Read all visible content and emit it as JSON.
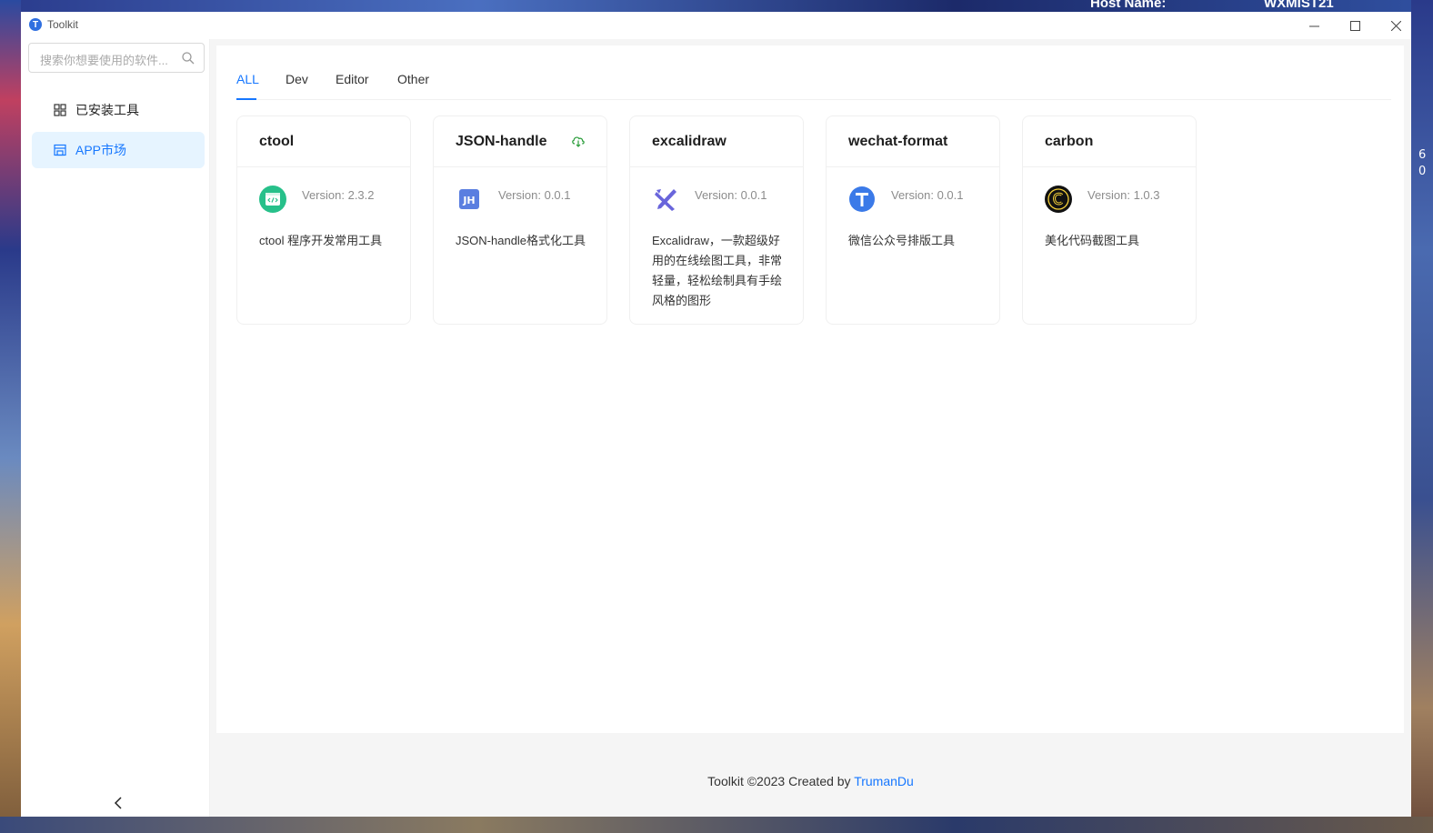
{
  "desktop": {
    "host_label": "Host Name:",
    "host_value": "WXMIST21",
    "edge_digits": [
      "6",
      "0"
    ]
  },
  "window": {
    "title": "Toolkit",
    "logo_letter": "T",
    "controls": [
      "minimize",
      "maximize",
      "close"
    ]
  },
  "sidebar": {
    "search_placeholder": "搜索你想要使用的软件...",
    "items": [
      {
        "label": "已安装工具",
        "icon": "grid-icon",
        "active": false
      },
      {
        "label": "APP市场",
        "icon": "store-icon",
        "active": true
      }
    ],
    "collapse_icon": "chevron-left-icon"
  },
  "tabs": [
    {
      "label": "ALL",
      "active": true
    },
    {
      "label": "Dev",
      "active": false
    },
    {
      "label": "Editor",
      "active": false
    },
    {
      "label": "Other",
      "active": false
    }
  ],
  "cards": [
    {
      "title": "ctool",
      "version": "Version: 2.3.2",
      "description": "ctool 程序开发常用工具",
      "logo": "ctool-logo",
      "downloadable": false
    },
    {
      "title": "JSON-handle",
      "version": "Version: 0.0.1",
      "description": "JSON-handle格式化工具",
      "logo": "json-handle-logo",
      "downloadable": true
    },
    {
      "title": "excalidraw",
      "version": "Version: 0.0.1",
      "description": "Excalidraw，一款超级好用的在线绘图工具，非常轻量，轻松绘制具有手绘风格的图形",
      "logo": "excalidraw-logo",
      "downloadable": false
    },
    {
      "title": "wechat-format",
      "version": "Version: 0.0.1",
      "description": "微信公众号排版工具",
      "logo": "wechat-format-logo",
      "downloadable": false
    },
    {
      "title": "carbon",
      "version": "Version: 1.0.3",
      "description": "美化代码截图工具",
      "logo": "carbon-logo",
      "downloadable": false
    }
  ],
  "footer": {
    "text": "Toolkit ©2023 Created by ",
    "author": "TrumanDu"
  },
  "colors": {
    "accent": "#1677ff",
    "active_nav_bg": "#e6f4ff",
    "cloud_green": "#2a9d3a"
  }
}
